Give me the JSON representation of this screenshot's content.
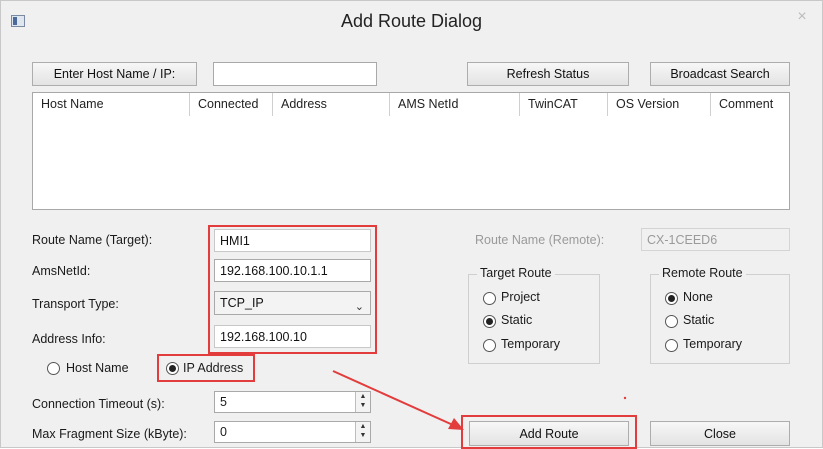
{
  "window": {
    "title": "Add Route Dialog",
    "close_glyph": "×"
  },
  "top_bar": {
    "enter_host_label": "Enter Host Name / IP:",
    "host_input_value": "",
    "refresh_label": "Refresh Status",
    "broadcast_label": "Broadcast Search"
  },
  "table": {
    "columns": [
      "Host Name",
      "Connected",
      "Address",
      "AMS NetId",
      "TwinCAT",
      "OS Version",
      "Comment"
    ],
    "rows": []
  },
  "form": {
    "route_name_label": "Route Name (Target):",
    "route_name_value": "HMI1",
    "amsnetid_label": "AmsNetId:",
    "amsnetid_value": "192.168.100.10.1.1",
    "transport_label": "Transport Type:",
    "transport_value": "TCP_IP",
    "address_label": "Address Info:",
    "address_value": "192.168.100.10",
    "host_name_option": "Host Name",
    "ip_address_option": "IP Address",
    "address_mode_selected": "IP Address",
    "conn_timeout_label": "Connection Timeout (s):",
    "conn_timeout_value": "5",
    "max_frag_label": "Max Fragment Size (kByte):",
    "max_frag_value": "0"
  },
  "remote": {
    "route_name_remote_label": "Route Name (Remote):",
    "route_name_remote_value": "CX-1CEED6"
  },
  "target_route": {
    "title": "Target Route",
    "options": [
      "Project",
      "Static",
      "Temporary"
    ],
    "selected": "Static"
  },
  "remote_route": {
    "title": "Remote Route",
    "options": [
      "None",
      "Static",
      "Temporary"
    ],
    "selected": "None"
  },
  "buttons": {
    "add_route": "Add Route",
    "close": "Close"
  },
  "annotation": {
    "highlight_color": "#e23c3c"
  }
}
